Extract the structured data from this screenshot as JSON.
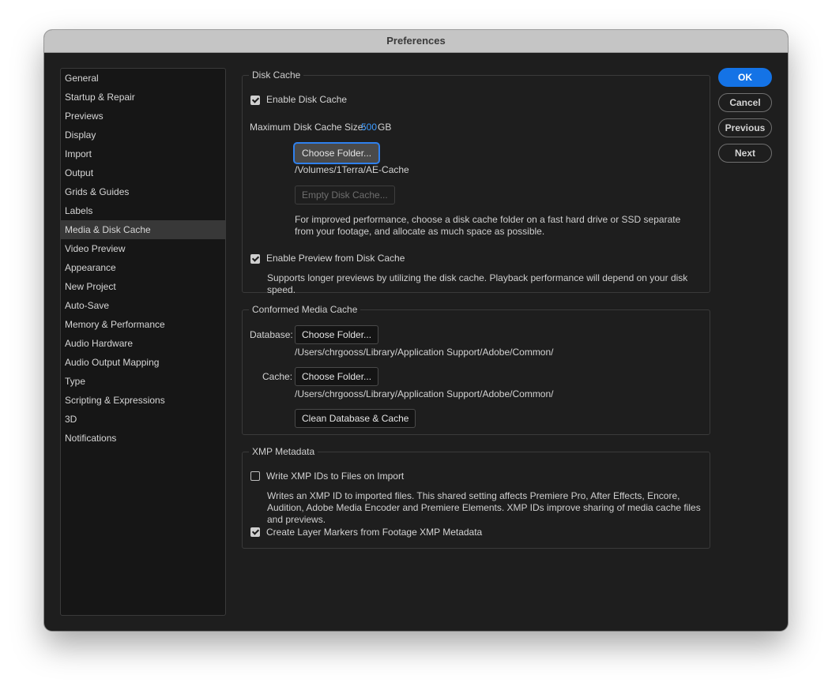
{
  "window": {
    "title": "Preferences"
  },
  "sidebar": {
    "items": [
      {
        "label": "General"
      },
      {
        "label": "Startup & Repair"
      },
      {
        "label": "Previews"
      },
      {
        "label": "Display"
      },
      {
        "label": "Import"
      },
      {
        "label": "Output"
      },
      {
        "label": "Grids & Guides"
      },
      {
        "label": "Labels"
      },
      {
        "label": "Media & Disk Cache"
      },
      {
        "label": "Video Preview"
      },
      {
        "label": "Appearance"
      },
      {
        "label": "New Project"
      },
      {
        "label": "Auto-Save"
      },
      {
        "label": "Memory & Performance"
      },
      {
        "label": "Audio Hardware"
      },
      {
        "label": "Audio Output Mapping"
      },
      {
        "label": "Type"
      },
      {
        "label": "Scripting & Expressions"
      },
      {
        "label": "3D"
      },
      {
        "label": "Notifications"
      }
    ],
    "selected": "Media & Disk Cache"
  },
  "disk_cache": {
    "title": "Disk Cache",
    "enable_label": "Enable Disk Cache",
    "enable_checked": true,
    "max_size_label": "Maximum Disk Cache Size:",
    "max_size_value": "500",
    "max_size_unit": "GB",
    "choose_folder_label": "Choose Folder...",
    "folder_path": "/Volumes/1Terra/AE-Cache",
    "empty_label": "Empty Disk Cache...",
    "help_text": "For improved performance, choose a disk cache folder on a fast hard drive or SSD separate from your footage, and allocate as much space as possible.",
    "preview_label": "Enable Preview from Disk Cache",
    "preview_checked": true,
    "preview_help": "Supports longer previews by utilizing the disk cache. Playback performance will depend on your disk speed."
  },
  "conformed": {
    "title": "Conformed Media Cache",
    "database_label": "Database:",
    "database_button": "Choose Folder...",
    "database_path": "/Users/chrgooss/Library/Application Support/Adobe/Common/",
    "cache_label": "Cache:",
    "cache_button": "Choose Folder...",
    "cache_path": "/Users/chrgooss/Library/Application Support/Adobe/Common/",
    "clean_label": "Clean Database & Cache"
  },
  "xmp": {
    "title": "XMP Metadata",
    "write_label": "Write XMP IDs to Files on Import",
    "write_checked": false,
    "write_help": "Writes an XMP ID to imported files. This shared setting affects Premiere Pro, After Effects, Encore, Audition, Adobe Media Encoder and Premiere Elements. XMP IDs improve sharing of media cache files and previews.",
    "markers_label": "Create Layer Markers from Footage XMP Metadata",
    "markers_checked": true
  },
  "actions": {
    "ok": "OK",
    "cancel": "Cancel",
    "previous": "Previous",
    "next": "Next"
  },
  "colors": {
    "accent": "#1473e6",
    "value_blue": "#3e9cff",
    "focus_ring": "#2f80ed"
  }
}
